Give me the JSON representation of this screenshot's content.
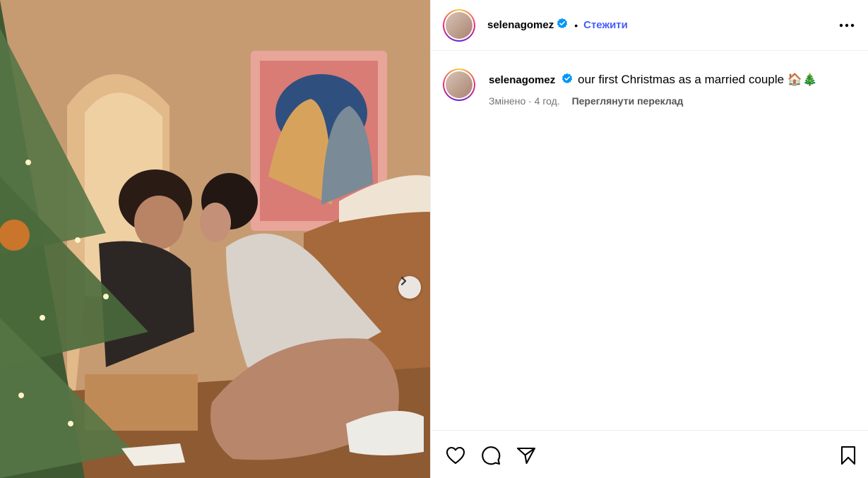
{
  "post": {
    "username": "selenagomez",
    "follow_label": "Стежити",
    "separator": "•",
    "caption": "our first Christmas as a married couple 🏠🎄",
    "meta_edited": "Змінено · 4 год.",
    "translate_label": "Переглянути переклад"
  },
  "icons": {
    "verified": "verified-badge-icon",
    "more": "more-options-icon",
    "next": "chevron-right-icon",
    "like": "heart-icon",
    "comment": "comment-icon",
    "share": "paper-plane-icon",
    "save": "bookmark-icon"
  },
  "colors": {
    "accent": "#4a5df9",
    "verified": "#0095f6",
    "meta": "#737373",
    "divider": "#efefef"
  }
}
